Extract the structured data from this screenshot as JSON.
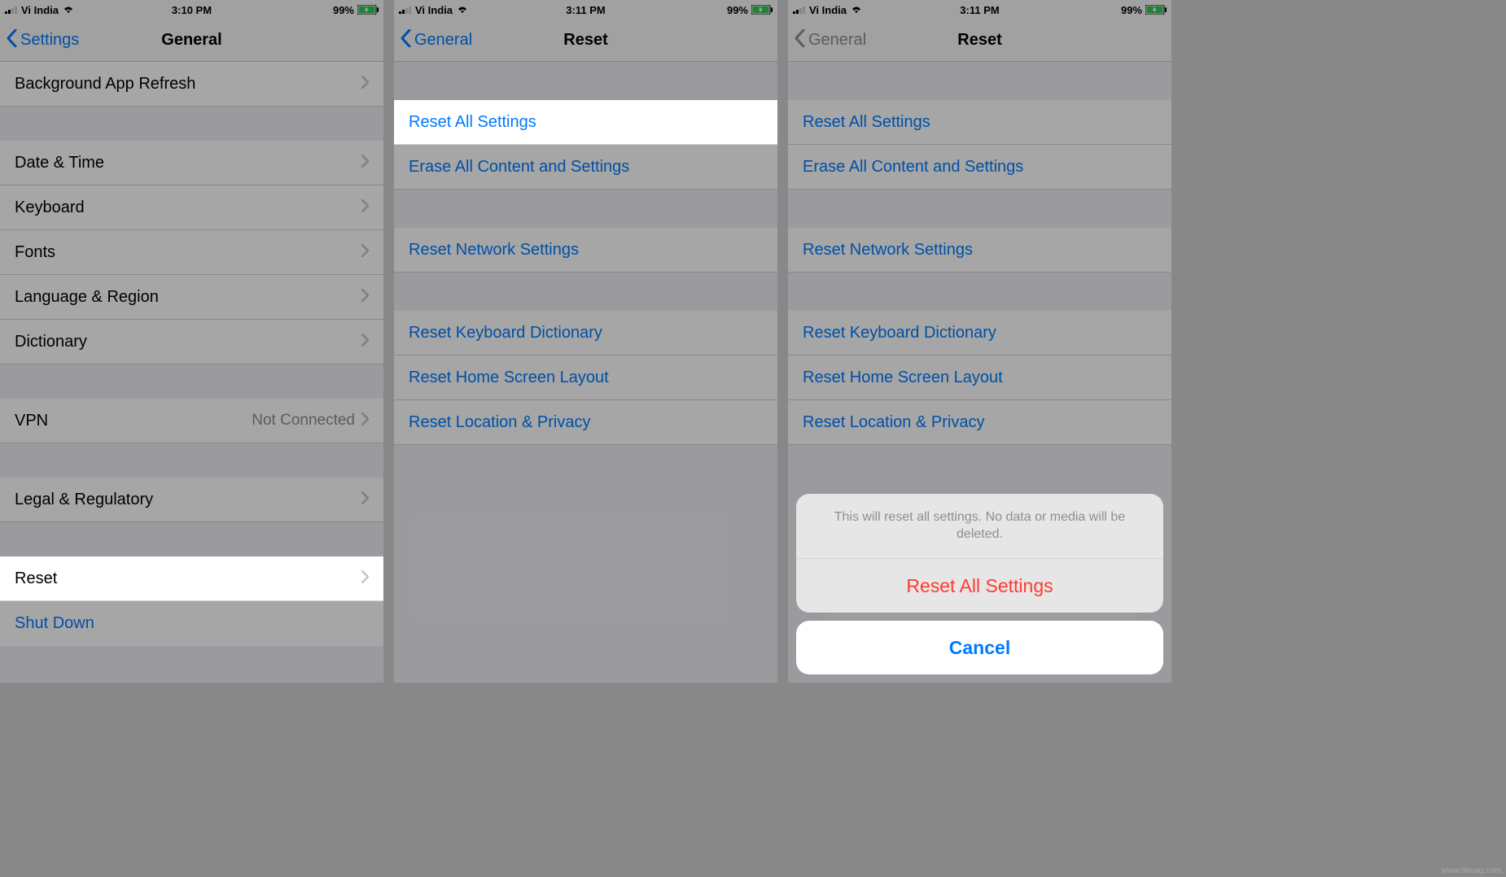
{
  "status": {
    "carrier": "Vi India",
    "battery_pct": "99%"
  },
  "screen1": {
    "time": "3:10 PM",
    "back_label": "Settings",
    "title": "General",
    "rows": {
      "bg_refresh": "Background App Refresh",
      "date_time": "Date & Time",
      "keyboard": "Keyboard",
      "fonts": "Fonts",
      "lang_region": "Language & Region",
      "dictionary": "Dictionary",
      "vpn": "VPN",
      "vpn_value": "Not Connected",
      "legal": "Legal & Regulatory",
      "reset": "Reset",
      "shutdown": "Shut Down"
    }
  },
  "screen2": {
    "time": "3:11 PM",
    "back_label": "General",
    "title": "Reset",
    "rows": {
      "reset_all": "Reset All Settings",
      "erase_all": "Erase All Content and Settings",
      "reset_network": "Reset Network Settings",
      "reset_keyboard": "Reset Keyboard Dictionary",
      "reset_home": "Reset Home Screen Layout",
      "reset_location": "Reset Location & Privacy"
    }
  },
  "screen3": {
    "time": "3:11 PM",
    "back_label": "General",
    "title": "Reset",
    "sheet": {
      "message": "This will reset all settings. No data or media will be deleted.",
      "confirm": "Reset All Settings",
      "cancel": "Cancel"
    }
  },
  "watermark": "www.deuaq.com"
}
